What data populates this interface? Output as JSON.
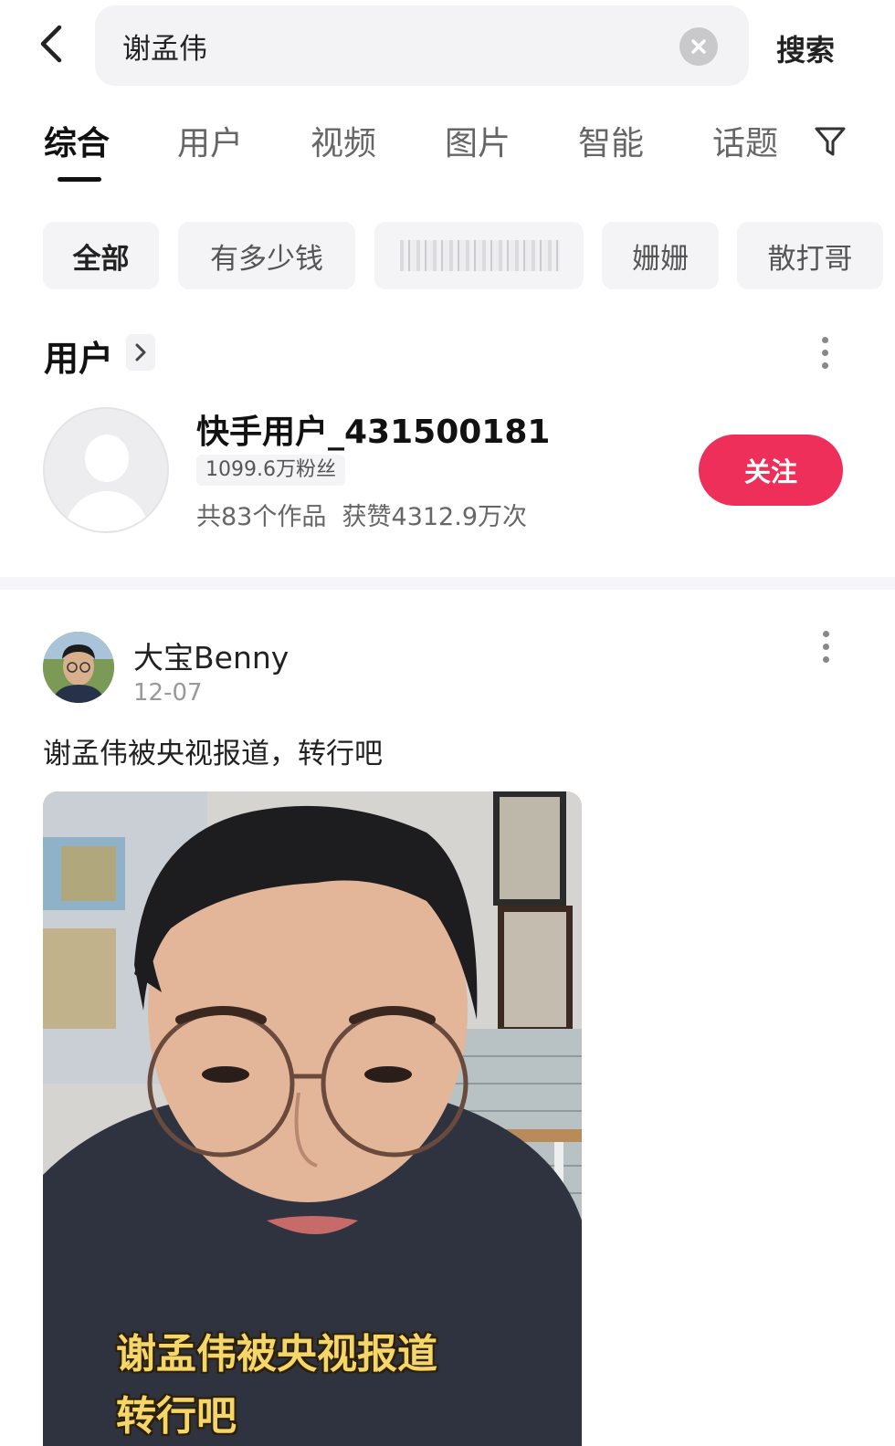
{
  "search": {
    "query": "谢孟伟",
    "submit_label": "搜索"
  },
  "tabs": [
    {
      "label": "综合"
    },
    {
      "label": "用户"
    },
    {
      "label": "视频"
    },
    {
      "label": "图片"
    },
    {
      "label": "智能"
    },
    {
      "label": "话题"
    }
  ],
  "chips": [
    {
      "label": "全部"
    },
    {
      "label": "有多少钱"
    },
    {
      "label": "姗姗"
    },
    {
      "label": "散打哥"
    }
  ],
  "user_section": {
    "title": "用户",
    "user": {
      "name": "快手用户_431500181",
      "fans": "1099.6万粉丝",
      "stats": "共83个作品  获赞4312.9万次",
      "follow_label": "关注"
    }
  },
  "post": {
    "author": "大宝Benny",
    "date": "12-07",
    "text": "谢孟伟被央视报道，转行吧",
    "caption_line1": "谢孟伟被央视报道",
    "caption_line2": "转行吧"
  },
  "colors": {
    "accent": "#ee2f5a",
    "caption": "#f5d66a"
  },
  "icons": [
    "back-arrow-icon",
    "clear-icon",
    "filter-icon",
    "chevron-right-icon",
    "more-vertical-icon"
  ]
}
